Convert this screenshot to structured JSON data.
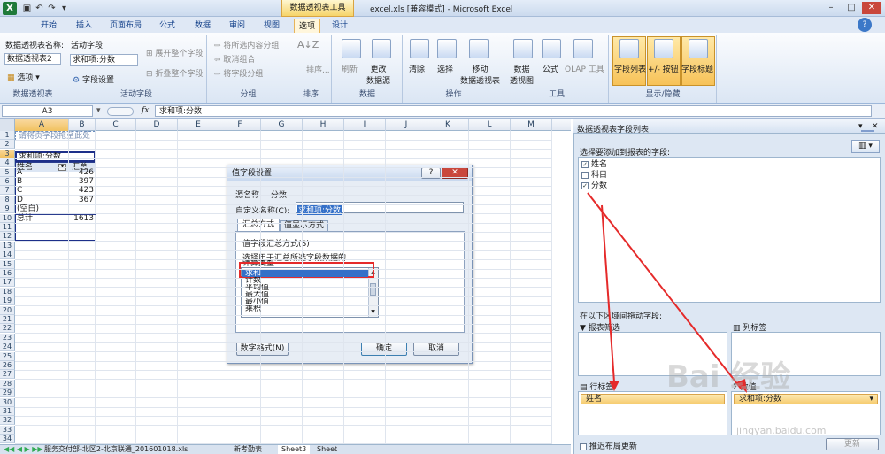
{
  "titlebar": {
    "context_tool": "数据透视表工具",
    "title": "excel.xls [兼容模式] - Microsoft Excel"
  },
  "tabs": [
    "开始",
    "插入",
    "页面布局",
    "公式",
    "数据",
    "审阅",
    "视图",
    "选项",
    "设计"
  ],
  "active_tab": "选项",
  "ribbon": {
    "pivot_name_label": "数据透视表名称:",
    "pivot_name_value": "数据透视表2",
    "options_btn": "选项",
    "group1": "数据透视表",
    "active_field_label": "活动字段:",
    "active_field_value": "求和项:分数",
    "field_settings": "字段设置",
    "expand": "展开整个字段",
    "collapse": "折叠整个字段",
    "group2": "活动字段",
    "g3_1": "将所选内容分组",
    "g3_2": "取消组合",
    "g3_3": "将字段分组",
    "group3": "分组",
    "sort": "排序...",
    "group4": "排序",
    "refresh": "刷新",
    "change_source": "更改\n数据源",
    "group5": "数据",
    "clear": "清除",
    "select": "选择",
    "move": "移动\n数据透视表",
    "group6": "操作",
    "pivotchart": "数据\n透视图",
    "formulas": "公式",
    "olap": "OLAP 工具",
    "group7": "工具",
    "field_list": "字段列表",
    "buttons": "+/- 按钮",
    "headers": "字段标题",
    "group8": "显示/隐藏"
  },
  "formula": {
    "namebox": "A3",
    "fx": "fx",
    "content": "求和项:分数"
  },
  "columns": [
    "A",
    "B",
    "C",
    "D",
    "E",
    "F",
    "G",
    "H",
    "I",
    "J",
    "K",
    "L",
    "M"
  ],
  "rows": [
    "1",
    "2",
    "3",
    "4",
    "5",
    "6",
    "7",
    "8",
    "9",
    "10",
    "11",
    "12",
    "13",
    "14",
    "15",
    "16",
    "17",
    "18",
    "19",
    "20",
    "21",
    "22",
    "23",
    "24",
    "25",
    "26",
    "27",
    "28",
    "29",
    "30",
    "31",
    "32",
    "33",
    "34"
  ],
  "sheet": {
    "r1": "请将页字段拖至此处",
    "r3a": "求和项:分数",
    "r4a": "姓名",
    "r4b": "汇总",
    "data": [
      {
        "n": "A",
        "v": "426"
      },
      {
        "n": "B",
        "v": "397"
      },
      {
        "n": "C",
        "v": "423"
      },
      {
        "n": "D",
        "v": "367"
      },
      {
        "n": "(空白)",
        "v": ""
      },
      {
        "n": "总计",
        "v": "1613"
      }
    ]
  },
  "sheettabs": [
    "服务交付部-北区2-北京联通_201601018.xls",
    "新考勤表",
    "Sheet3",
    "Sheet"
  ],
  "pane": {
    "title": "数据透视表字段列表",
    "choose": "选择要添加到报表的字段:",
    "fields": [
      {
        "label": "姓名",
        "checked": true
      },
      {
        "label": "科目",
        "checked": false
      },
      {
        "label": "分数",
        "checked": true
      }
    ],
    "drag": "在以下区域间拖动字段:",
    "report_filter": "报表筛选",
    "col_labels": "列标签",
    "row_labels": "行标签",
    "values": "数值",
    "row_item": "姓名",
    "value_item": "求和项:分数",
    "defer": "推迟布局更新",
    "update": "更新"
  },
  "dialog": {
    "title": "值字段设置",
    "help": "?",
    "close": "✕",
    "source_label": "源名称:",
    "source_value": "分数",
    "custom_label": "自定义名称(C):",
    "custom_value": "求和项:分数",
    "tab1": "汇总方式",
    "tab2": "值显示方式",
    "summarize_label": "值字段汇总方式(S)",
    "choose_calc": "选择用于汇总所选字段数据的",
    "calc_type": "计算类型",
    "items": [
      "求和",
      "计数",
      "平均值",
      "最大值",
      "最小值",
      "乘积"
    ],
    "number_format": "数字格式(N)",
    "ok": "确定",
    "cancel": "取消"
  },
  "watermark": {
    "main": "Bai 经验",
    "sub": "jingyan.baidu.com"
  },
  "colors": {
    "red_annotation": "#e52a2a",
    "accent": "#f7c258"
  }
}
